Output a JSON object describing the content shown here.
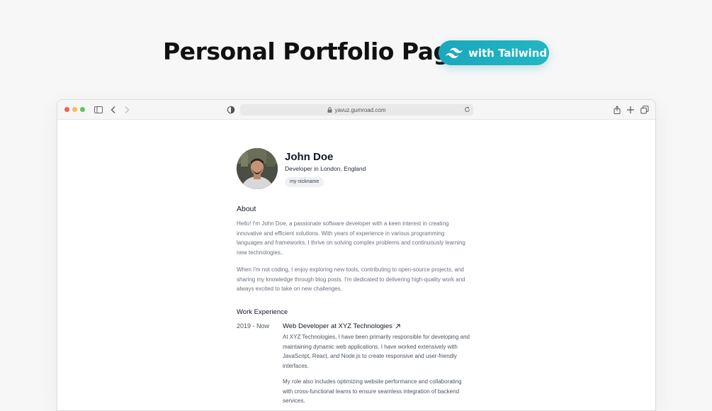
{
  "hero": {
    "title": "Personal Portfolio Page",
    "badge_label": "with Tailwind",
    "badge_icon": "tailwind-logo-icon",
    "badge_color": "#1ba7bd"
  },
  "browser": {
    "url": "yavuz.gumroad.com",
    "traffic_lights": [
      "#ee5f57",
      "#f4bd4f",
      "#60c454"
    ],
    "toolbar_icons": [
      "sidebar-icon",
      "back-icon",
      "forward-icon",
      "shield-icon",
      "lock-icon",
      "reload-icon",
      "share-icon",
      "new-tab-icon",
      "tabs-overview-icon"
    ]
  },
  "profile": {
    "name": "John Doe",
    "location": "Developer in London, England",
    "nickname": "my nickname"
  },
  "about": {
    "heading": "About",
    "paragraphs": [
      "Hello! I'm John Doe, a passionate software developer with a keen interest in creating innovative and efficient solutions. With years of experience in various programming languages and frameworks, I thrive on solving complex problems and continuously learning new technologies..",
      "When I'm not coding, I enjoy exploring new tools, contributing to open-source projects, and sharing my knowledge through blog posts. I'm dedicated to delivering high-quality work and always excited to take on new challenges."
    ]
  },
  "work": {
    "heading": "Work Experience",
    "jobs": [
      {
        "period": "2019 - Now",
        "title": "Web Developer at XYZ Technologies",
        "paragraphs": [
          "At XYZ Technologies, I have been primarily responsible for developing and maintaining dynamic web applications. I have worked extensively with JavaScript, React, and Node.js to create responsive and user-friendly interfaces.",
          "My role also includes optimizing website performance and collaborating with cross-functional teams to ensure seamless integration of backend services."
        ]
      }
    ]
  }
}
